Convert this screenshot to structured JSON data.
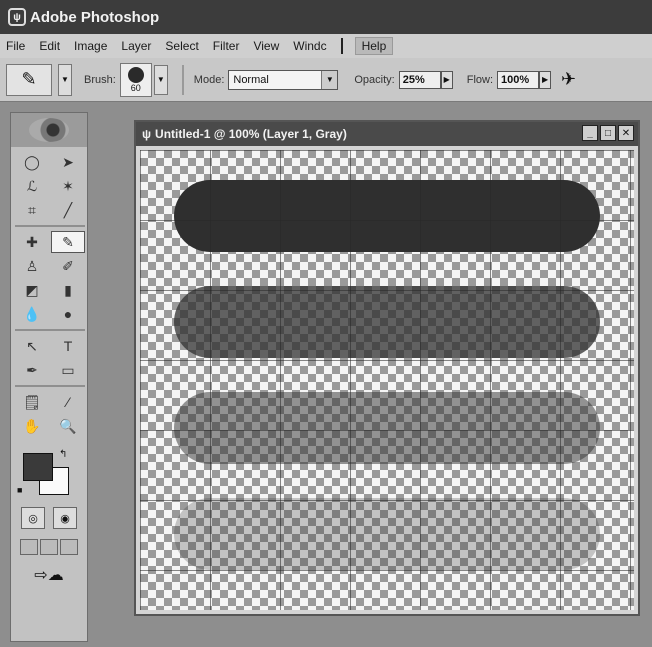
{
  "app": {
    "title": "Adobe Photoshop"
  },
  "menu": {
    "items": [
      "File",
      "Edit",
      "Image",
      "Layer",
      "Select",
      "Filter",
      "View",
      "Windc",
      "Help"
    ]
  },
  "options": {
    "brush_label": "Brush:",
    "brush_size": "60",
    "mode_label": "Mode:",
    "mode_value": "Normal",
    "opacity_label": "Opacity:",
    "opacity_value": "25%",
    "flow_label": "Flow:",
    "flow_value": "100%"
  },
  "document": {
    "title": "Untitled-1 @ 100% (Layer 1, Gray)",
    "strokes": [
      {
        "opacity_percent": 100
      },
      {
        "opacity_percent": 75
      },
      {
        "opacity_percent": 50
      },
      {
        "opacity_percent": 25
      }
    ]
  },
  "toolbox": {
    "tools": [
      "marquee-icon",
      "move-icon",
      "lasso-icon",
      "magic-wand-icon",
      "crop-icon",
      "slice-icon",
      "healing-icon",
      "brush-icon",
      "stamp-icon",
      "history-brush-icon",
      "eraser-icon",
      "gradient-icon",
      "blur-icon",
      "dodge-icon",
      "path-select-icon",
      "type-icon",
      "pen-icon",
      "shape-icon",
      "notes-icon",
      "eyedropper-icon",
      "hand-icon",
      "zoom-icon"
    ],
    "foreground_color": "#3a3a3a",
    "background_color": "#fafafa"
  },
  "colors": {
    "titlebar": "#3c3c3c",
    "menubar": "#cfcfcf",
    "stroke": "#2f2f2f"
  }
}
